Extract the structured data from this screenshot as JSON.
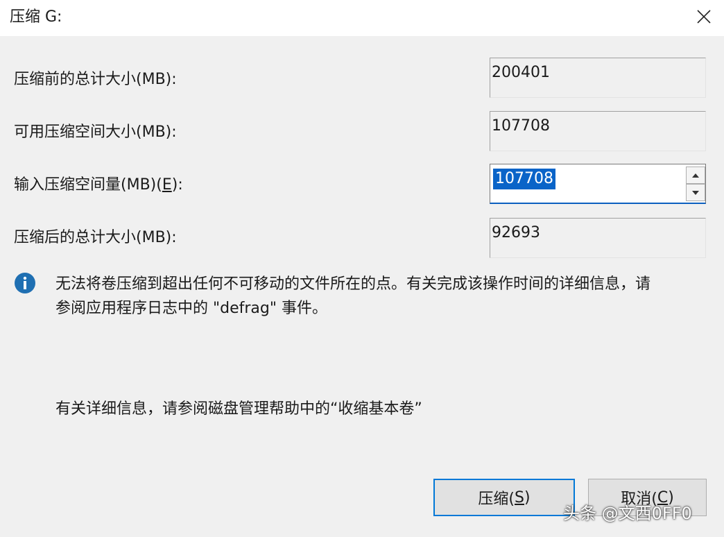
{
  "window": {
    "title": "压缩 G:"
  },
  "fields": [
    {
      "label": "压缩前的总计大小(MB):",
      "value": "200401"
    },
    {
      "label": "可用压缩空间大小(MB):",
      "value": "107708"
    },
    {
      "label_prefix": "输入压缩空间量(MB)(",
      "label_mnemonic": "E",
      "label_suffix": "):",
      "value": "107708"
    },
    {
      "label": "压缩后的总计大小(MB):",
      "value": "92693"
    }
  ],
  "info": {
    "icon": "info-icon",
    "line1": "无法将卷压缩到超出任何不可移动的文件所在的点。有关完成该操作时间的详细信息，请",
    "line2": "参阅应用程序日志中的 \"defrag\" 事件。"
  },
  "help": {
    "text": "有关详细信息，请参阅磁盘管理帮助中的“收缩基本卷”"
  },
  "buttons": {
    "shrink_prefix": "压缩(",
    "shrink_mnemonic": "S",
    "shrink_suffix": ")",
    "cancel_prefix": "取消(",
    "cancel_mnemonic": "C",
    "cancel_suffix": ")"
  },
  "watermark": "头条 @文西0FF0",
  "colors": {
    "selection": "#0a64c8",
    "default_button_border": "#0078d7",
    "info_icon": "#1f6fb2"
  }
}
